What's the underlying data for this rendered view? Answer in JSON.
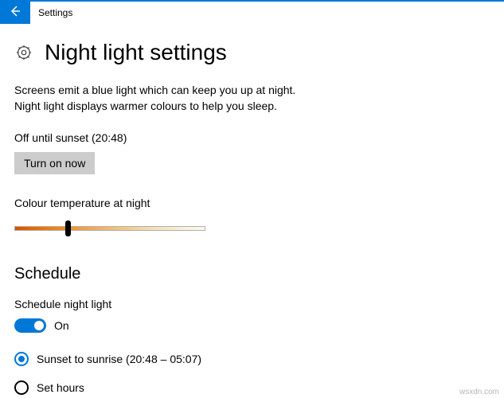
{
  "app_title": "Settings",
  "page": {
    "title": "Night light settings",
    "description": "Screens emit a blue light which can keep you up at night. Night light displays warmer colours to help you sleep.",
    "status": "Off until sunset (20:48)",
    "turn_on_button": "Turn on now",
    "color_temp_label": "Colour temperature at night",
    "slider_value_percent": 27
  },
  "schedule": {
    "header": "Schedule",
    "toggle_label": "Schedule night light",
    "toggle_on": true,
    "toggle_state_text": "On",
    "options": [
      {
        "label": "Sunset to sunrise (20:48 – 05:07)",
        "selected": true
      },
      {
        "label": "Set hours",
        "selected": false
      }
    ]
  },
  "watermark": "wsxdn.com",
  "colors": {
    "accent": "#0078d7"
  }
}
